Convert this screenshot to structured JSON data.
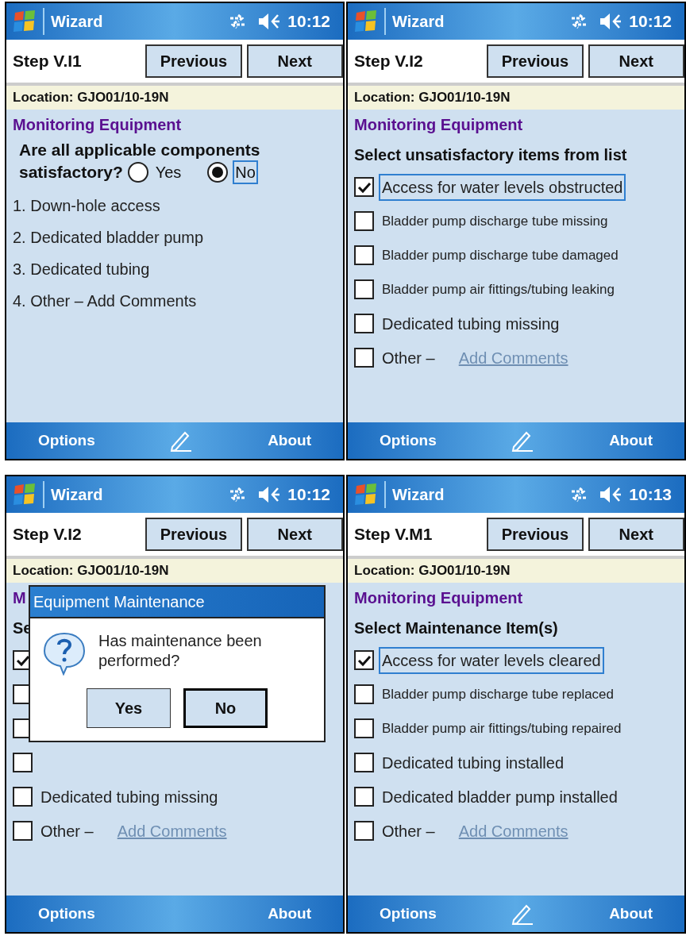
{
  "screens": [
    {
      "title_bar": {
        "app": "Wizard",
        "time": "10:12"
      },
      "step": "Step V.I1",
      "nav_buttons": [
        "Previous",
        "Next"
      ],
      "location": "Location: GJO01/10-19N",
      "section": "Monitoring Equipment",
      "kind": "question",
      "question_lines": [
        "Are all applicable components",
        "satisfactory?"
      ],
      "options": [
        {
          "label": "Yes",
          "selected": false,
          "focused": false
        },
        {
          "label": "No",
          "selected": true,
          "focused": true
        }
      ],
      "items": [
        "1. Down-hole access",
        "2. Dedicated bladder pump",
        "3. Dedicated tubing",
        "4. Other – Add Comments"
      ],
      "menu": {
        "left": "Options",
        "right": "About",
        "input_icon": true
      }
    },
    {
      "title_bar": {
        "app": "Wizard",
        "time": "10:12"
      },
      "step": "Step V.I2",
      "nav_buttons": [
        "Previous",
        "Next"
      ],
      "location": "Location: GJO01/10-19N",
      "section": "Monitoring Equipment",
      "kind": "checklist",
      "heading": "Select unsatisfactory items from list",
      "checklist": [
        {
          "label": "Access for water levels obstructed",
          "checked": true,
          "focused": true,
          "small": false
        },
        {
          "label": "Bladder pump discharge tube missing",
          "checked": false,
          "focused": false,
          "small": true
        },
        {
          "label": "Bladder pump discharge tube damaged",
          "checked": false,
          "focused": false,
          "small": true
        },
        {
          "label": "Bladder pump air fittings/tubing leaking",
          "checked": false,
          "focused": false,
          "small": true
        },
        {
          "label": "Dedicated tubing missing",
          "checked": false,
          "focused": false,
          "small": false
        },
        {
          "label": "Other –",
          "link": "Add Comments",
          "checked": false,
          "focused": false,
          "small": false
        }
      ],
      "menu": {
        "left": "Options",
        "right": "About",
        "input_icon": true
      }
    },
    {
      "title_bar": {
        "app": "Wizard",
        "time": "10:12"
      },
      "step": "Step V.I2",
      "nav_buttons": [
        "Previous",
        "Next"
      ],
      "location": "Location: GJO01/10-19N",
      "section": "M",
      "kind": "checklist",
      "heading": "Se",
      "checklist": [
        {
          "checked": true
        },
        {
          "checked": false
        },
        {
          "checked": false
        },
        {
          "checked": false
        },
        {
          "label": "Dedicated tubing missing",
          "checked": false,
          "focused": false,
          "small": false
        },
        {
          "label": "Other –",
          "link": "Add Comments",
          "checked": false,
          "focused": false,
          "small": false
        }
      ],
      "dialog": {
        "title": "Equipment Maintenance",
        "message": "Has maintenance been performed?",
        "buttons": [
          {
            "label": "Yes",
            "default": false
          },
          {
            "label": "No",
            "default": true
          }
        ]
      },
      "menu": {
        "left": "Options",
        "right": "About",
        "input_icon": false
      }
    },
    {
      "title_bar": {
        "app": "Wizard",
        "time": "10:13"
      },
      "step": "Step V.M1",
      "nav_buttons": [
        "Previous",
        "Next"
      ],
      "location": "Location: GJO01/10-19N",
      "section": "Monitoring Equipment",
      "kind": "checklist",
      "heading": "Select Maintenance Item(s)",
      "checklist": [
        {
          "label": "Access for water levels cleared",
          "checked": true,
          "focused": true,
          "small": false
        },
        {
          "label": "Bladder pump discharge tube replaced",
          "checked": false,
          "focused": false,
          "small": true
        },
        {
          "label": "Bladder pump air fittings/tubing repaired",
          "checked": false,
          "focused": false,
          "small": true
        },
        {
          "label": "Dedicated tubing installed",
          "checked": false,
          "focused": false,
          "small": false
        },
        {
          "label": "Dedicated bladder pump installed",
          "checked": false,
          "focused": false,
          "small": false
        },
        {
          "label": "Other –",
          "link": "Add Comments",
          "checked": false,
          "focused": false,
          "small": false
        }
      ],
      "menu": {
        "left": "Options",
        "right": "About",
        "input_icon": true
      }
    }
  ]
}
